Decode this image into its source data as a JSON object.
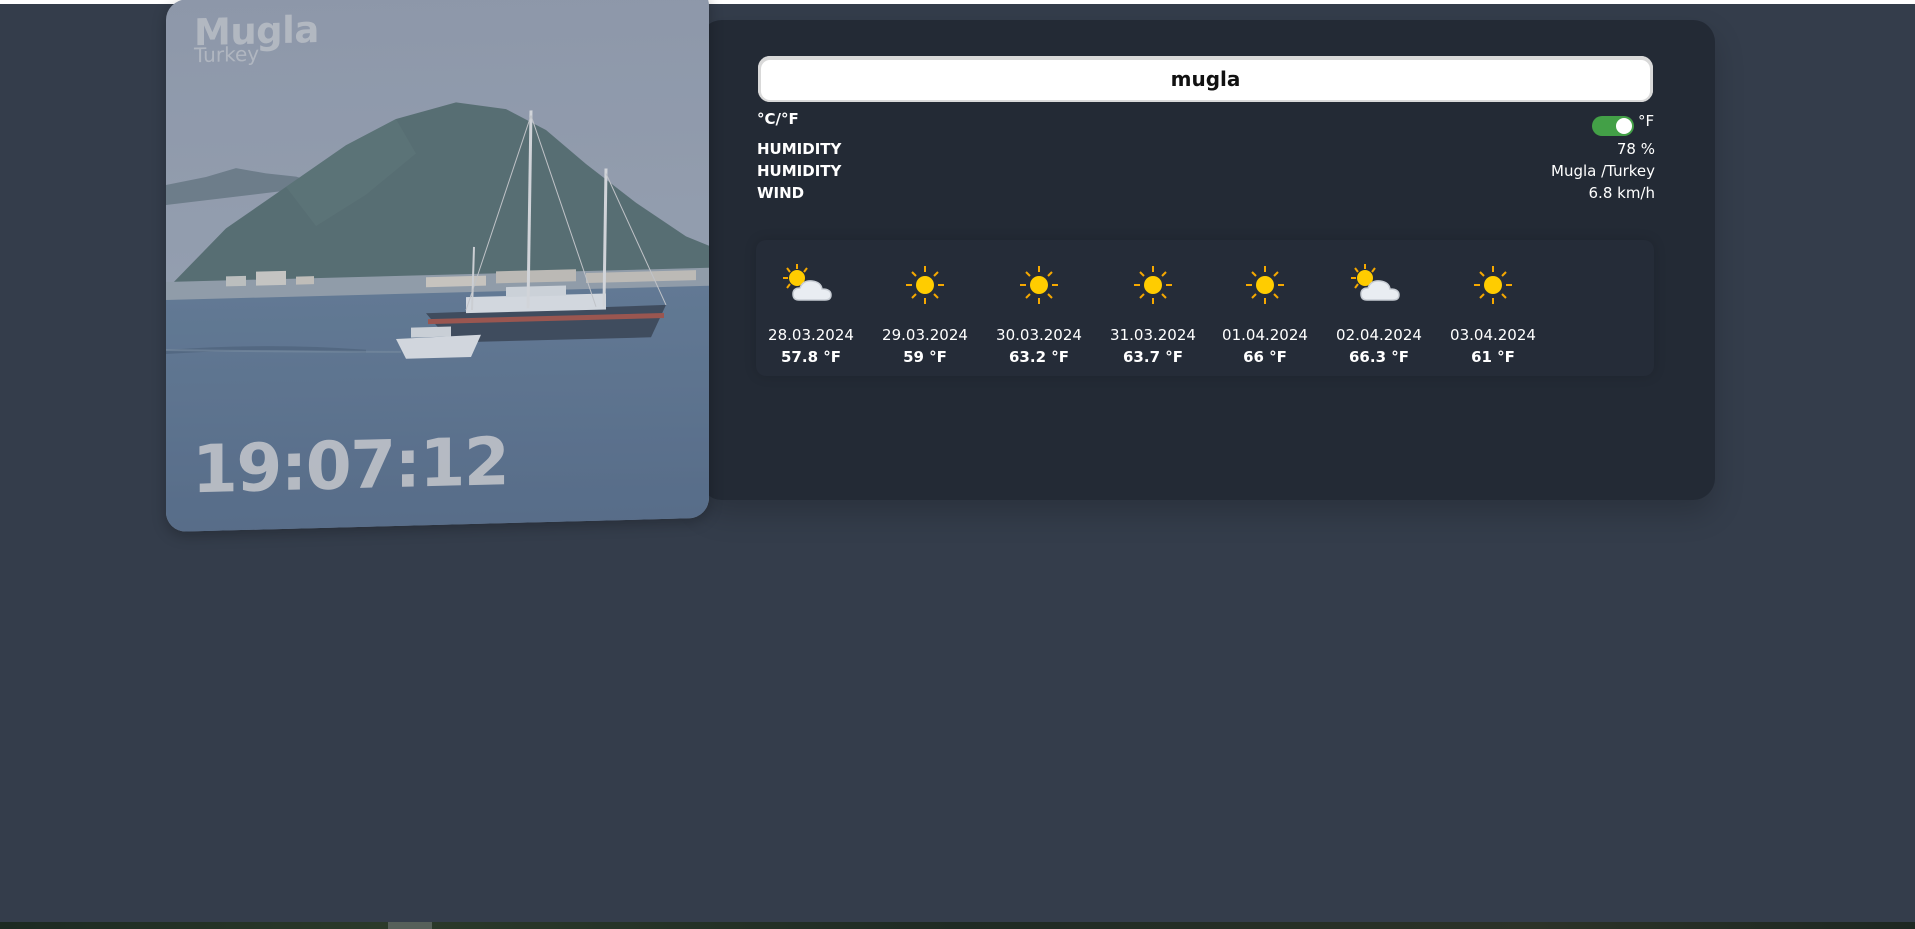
{
  "location": {
    "city": "Mugla",
    "country": "Turkey",
    "time": "19:07:12"
  },
  "search": {
    "value": "mugla"
  },
  "units": {
    "toggle_label": "°C/°F",
    "active_unit": "°F",
    "toggle_on": true,
    "toggle_color": "#43a047"
  },
  "details": [
    {
      "label": "HUMIDITY",
      "value": "78 %"
    },
    {
      "label": "HUMIDITY",
      "value": "Mugla /Turkey"
    },
    {
      "label": "WIND",
      "value": "6.8 km/h"
    }
  ],
  "forecast": [
    {
      "date": "28.03.2024",
      "temp": "57.8 °F",
      "icon": "partly-cloudy-icon"
    },
    {
      "date": "29.03.2024",
      "temp": "59 °F",
      "icon": "sun-icon"
    },
    {
      "date": "30.03.2024",
      "temp": "63.2 °F",
      "icon": "sun-icon"
    },
    {
      "date": "31.03.2024",
      "temp": "63.7 °F",
      "icon": "sun-icon"
    },
    {
      "date": "01.04.2024",
      "temp": "66 °F",
      "icon": "sun-icon"
    },
    {
      "date": "02.04.2024",
      "temp": "66.3 °F",
      "icon": "partly-cloudy-icon"
    },
    {
      "date": "03.04.2024",
      "temp": "61 °F",
      "icon": "sun-icon"
    }
  ],
  "colors": {
    "background": "#343d4b",
    "card": "#232a35",
    "sun": "#ffcc00",
    "sun_rays": "#f5a800"
  }
}
